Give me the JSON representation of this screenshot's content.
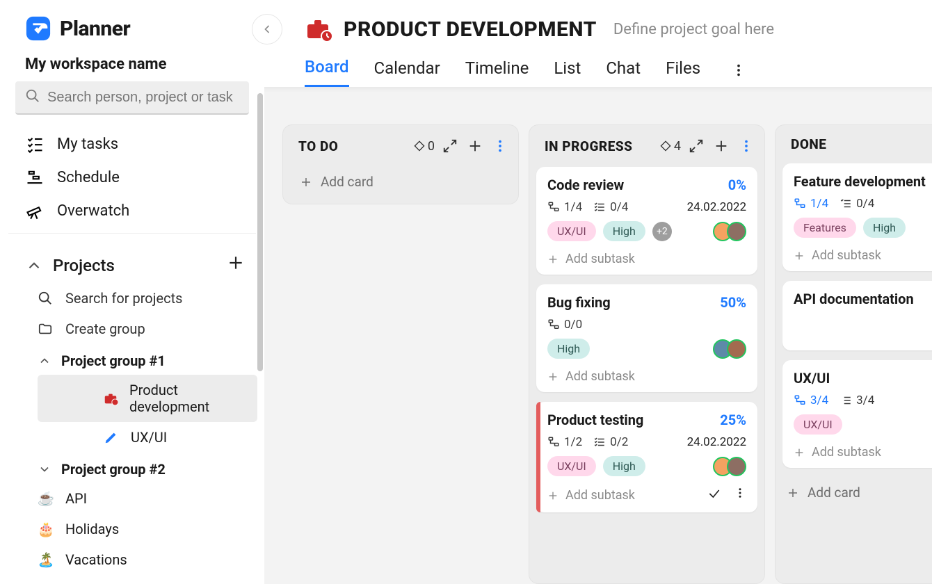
{
  "app": {
    "name": "Planner"
  },
  "workspace": {
    "name": "My workspace name"
  },
  "search": {
    "placeholder": "Search person, project or task"
  },
  "nav": {
    "my_tasks": "My tasks",
    "schedule": "Schedule",
    "overwatch": "Overwatch"
  },
  "projects": {
    "title": "Projects",
    "search_label": "Search for projects",
    "create_group_label": "Create group",
    "groups": [
      {
        "name": "Project group #1",
        "expanded": true,
        "items": [
          {
            "name": "Product development",
            "icon": "briefcase-red",
            "active": true
          },
          {
            "name": "UX/UI",
            "icon": "pen-blue",
            "active": false
          }
        ]
      },
      {
        "name": "Project group #2",
        "expanded": false,
        "items": []
      }
    ],
    "loose": [
      {
        "name": "API",
        "emoji": "☕"
      },
      {
        "name": "Holidays",
        "emoji": "🎂"
      },
      {
        "name": "Vacations",
        "emoji": "🏝️"
      }
    ]
  },
  "header": {
    "title": "PRODUCT DEVELOPMENT",
    "goal_placeholder": "Define project goal here"
  },
  "tabs": [
    "Board",
    "Calendar",
    "Timeline",
    "List",
    "Chat",
    "Files"
  ],
  "active_tab": "Board",
  "board": {
    "add_card_label": "Add card",
    "add_subtask_label": "Add subtask",
    "columns": [
      {
        "title": "TO DO",
        "diamond_count": "0",
        "cards": []
      },
      {
        "title": "IN PROGRESS",
        "diamond_count": "4",
        "cards": [
          {
            "title": "Code review",
            "percent": "0%",
            "statA": "1/4",
            "statB": "0/4",
            "date": "24.02.2022",
            "tags": [
              "UX/UI",
              "High"
            ],
            "extra_tags": "+2",
            "avatars": 2,
            "red_edge": false,
            "statA_blue": false
          },
          {
            "title": "Bug fixing",
            "percent": "50%",
            "statA": "0/0",
            "statB": "",
            "date": "",
            "tags": [
              "High"
            ],
            "extra_tags": "",
            "avatars": 2,
            "red_edge": false,
            "statA_blue": false
          },
          {
            "title": "Product testing",
            "percent": "25%",
            "statA": "1/2",
            "statB": "0/2",
            "date": "24.02.2022",
            "tags": [
              "UX/UI",
              "High"
            ],
            "extra_tags": "",
            "avatars": 2,
            "red_edge": true,
            "show_actions": true,
            "statA_blue": false
          }
        ]
      },
      {
        "title": "DONE",
        "diamond_count": "",
        "cards": [
          {
            "title": "Feature development",
            "percent": "",
            "statA": "1/4",
            "statB": "0/4",
            "date": "",
            "tags": [
              "Features",
              "High"
            ],
            "extra_tags": "",
            "avatars": 0,
            "statA_blue": true
          },
          {
            "title": "API documentation",
            "percent": "",
            "statA": "",
            "statB": "",
            "date": "",
            "tags": [],
            "extra_tags": "",
            "avatars": 0
          },
          {
            "title": "UX/UI",
            "percent": "",
            "statA": "3/4",
            "statB": "3/4",
            "date": "",
            "tags": [
              "UX/UI"
            ],
            "extra_tags": "",
            "avatars": 0,
            "statA_blue": true
          }
        ],
        "show_add_card_bottom": true
      }
    ]
  }
}
